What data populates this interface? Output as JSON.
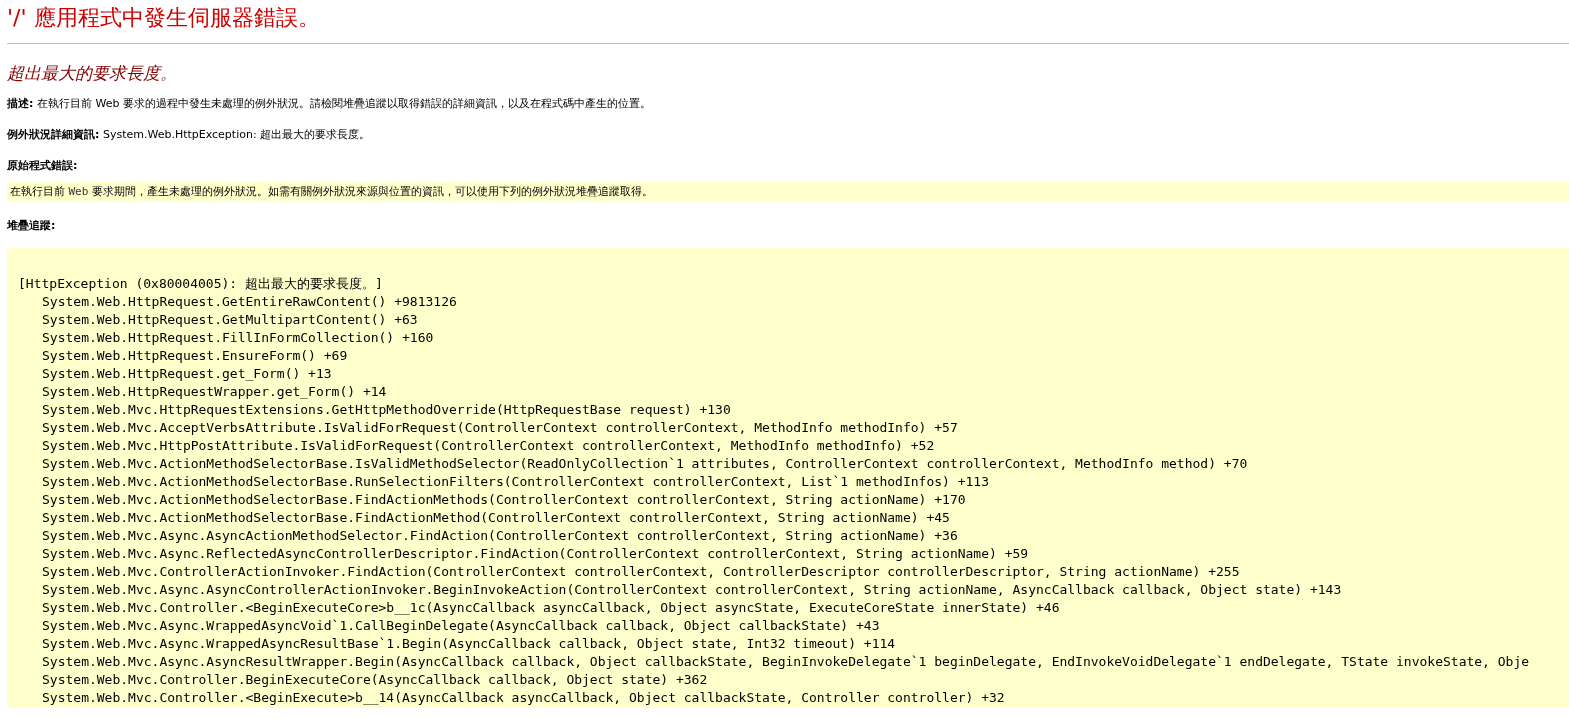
{
  "title": "'/' 應用程式中發生伺服器錯誤。",
  "subtitle": "超出最大的要求長度。",
  "description": {
    "label": "描述:",
    "text": "在執行目前 Web 要求的過程中發生未處理的例外狀況。請檢閱堆疊追蹤以取得錯誤的詳細資訊，以及在程式碼中產生的位置。"
  },
  "exception_details": {
    "label": "例外狀況詳細資訊:",
    "text": "System.Web.HttpException: 超出最大的要求長度。"
  },
  "source_error": {
    "label": "原始程式錯誤:",
    "parts": [
      {
        "kind": "text",
        "text": "在執行目前 "
      },
      {
        "kind": "code",
        "text": "Web"
      },
      {
        "kind": "text",
        "text": " 要求期間，產生未處理的例外狀況。如需有關例外狀況來源與位置的資訊，可以使用下列的例外狀況堆疊追蹤取得。"
      }
    ]
  },
  "stack_trace": {
    "label": "堆疊追蹤:",
    "exception": "[HttpException (0x80004005): 超出最大的要求長度。]",
    "frames": [
      "System.Web.HttpRequest.GetEntireRawContent() +9813126",
      "System.Web.HttpRequest.GetMultipartContent() +63",
      "System.Web.HttpRequest.FillInFormCollection() +160",
      "System.Web.HttpRequest.EnsureForm() +69",
      "System.Web.HttpRequest.get_Form() +13",
      "System.Web.HttpRequestWrapper.get_Form() +14",
      "System.Web.Mvc.HttpRequestExtensions.GetHttpMethodOverride(HttpRequestBase request) +130",
      "System.Web.Mvc.AcceptVerbsAttribute.IsValidForRequest(ControllerContext controllerContext, MethodInfo methodInfo) +57",
      "System.Web.Mvc.HttpPostAttribute.IsValidForRequest(ControllerContext controllerContext, MethodInfo methodInfo) +52",
      "System.Web.Mvc.ActionMethodSelectorBase.IsValidMethodSelector(ReadOnlyCollection`1 attributes, ControllerContext controllerContext, MethodInfo method) +70",
      "System.Web.Mvc.ActionMethodSelectorBase.RunSelectionFilters(ControllerContext controllerContext, List`1 methodInfos) +113",
      "System.Web.Mvc.ActionMethodSelectorBase.FindActionMethods(ControllerContext controllerContext, String actionName) +170",
      "System.Web.Mvc.ActionMethodSelectorBase.FindActionMethod(ControllerContext controllerContext, String actionName) +45",
      "System.Web.Mvc.Async.AsyncActionMethodSelector.FindAction(ControllerContext controllerContext, String actionName) +36",
      "System.Web.Mvc.Async.ReflectedAsyncControllerDescriptor.FindAction(ControllerContext controllerContext, String actionName) +59",
      "System.Web.Mvc.ControllerActionInvoker.FindAction(ControllerContext controllerContext, ControllerDescriptor controllerDescriptor, String actionName) +255",
      "System.Web.Mvc.Async.AsyncControllerActionInvoker.BeginInvokeAction(ControllerContext controllerContext, String actionName, AsyncCallback callback, Object state) +143",
      "System.Web.Mvc.Controller.<BeginExecuteCore>b__1c(AsyncCallback asyncCallback, Object asyncState, ExecuteCoreState innerState) +46",
      "System.Web.Mvc.Async.WrappedAsyncVoid`1.CallBeginDelegate(AsyncCallback callback, Object callbackState) +43",
      "System.Web.Mvc.Async.WrappedAsyncResultBase`1.Begin(AsyncCallback callback, Object state, Int32 timeout) +114",
      "System.Web.Mvc.Async.AsyncResultWrapper.Begin(AsyncCallback callback, Object callbackState, BeginInvokeDelegate`1 beginDelegate, EndInvokeVoidDelegate`1 endDelegate, TState invokeState, Obje",
      "System.Web.Mvc.Controller.BeginExecuteCore(AsyncCallback callback, Object state) +362",
      "System.Web.Mvc.Controller.<BeginExecute>b__14(AsyncCallback asyncCallback, Object callbackState, Controller controller) +32"
    ]
  }
}
